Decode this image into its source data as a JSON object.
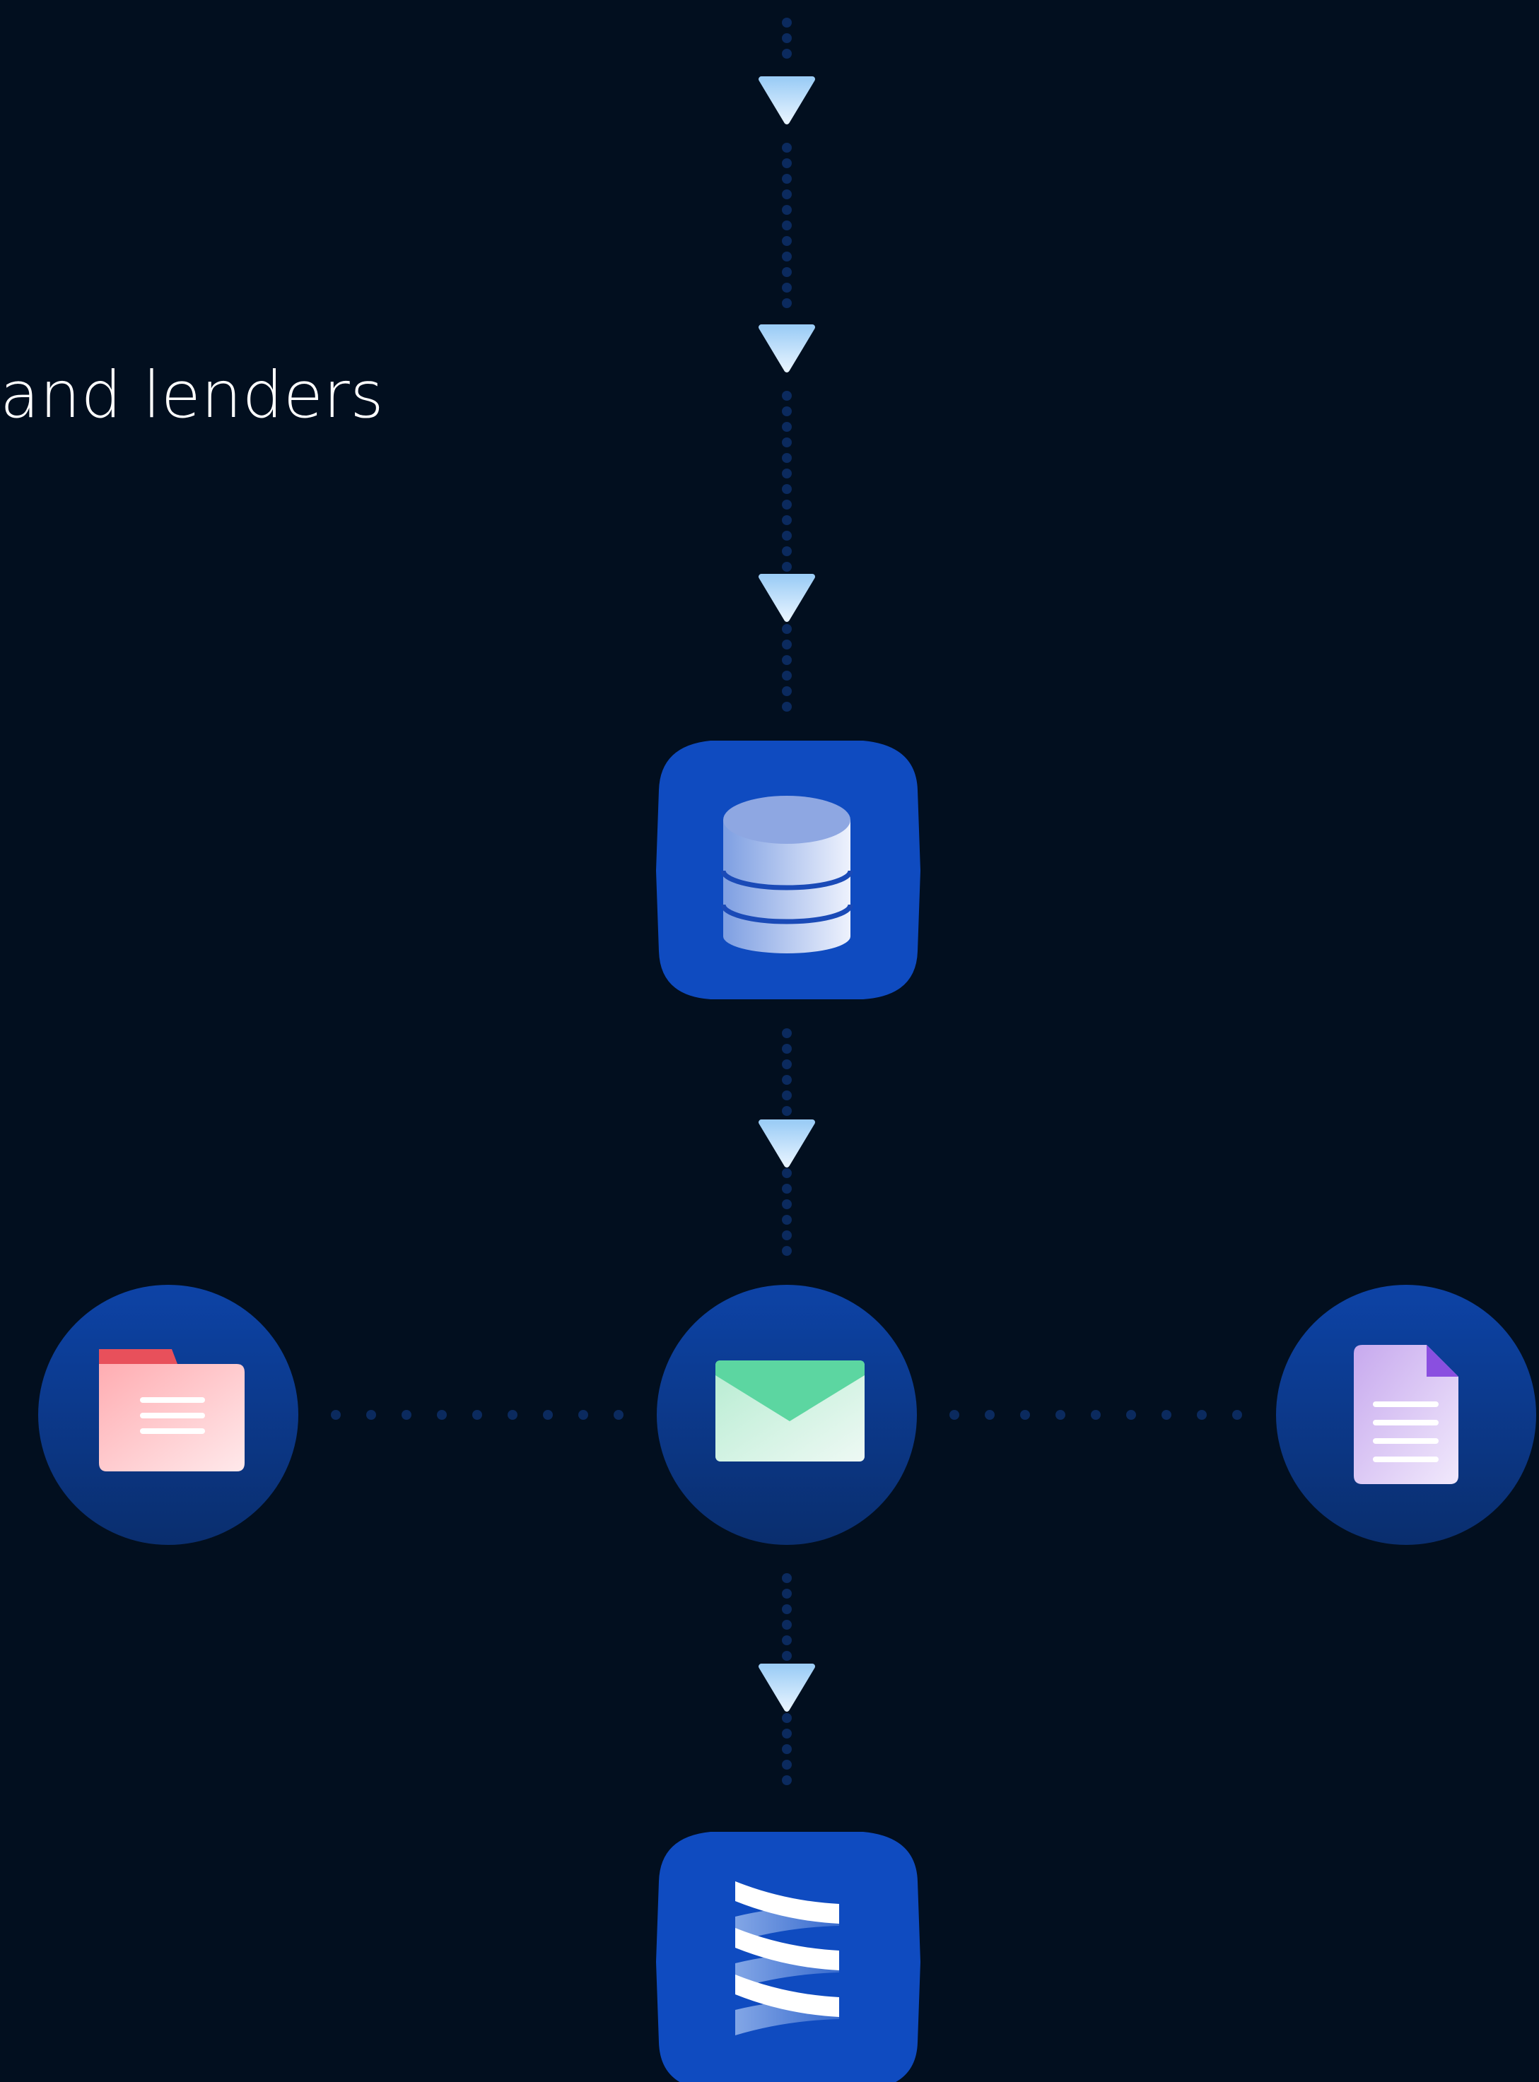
{
  "caption": "and lenders",
  "colors": {
    "background": "#020f1f",
    "connector_dot": "#0b2a5e",
    "arrow": "#c9e4fb",
    "node_blue": "#0f4bc0",
    "node_circle": "#0c3a8f",
    "folder_tab": "#e8505b",
    "envelope_flap": "#5cd6a1",
    "document_corner": "#8a4fe0"
  },
  "nodes": [
    {
      "name": "database-node",
      "icon": "database-icon"
    },
    {
      "name": "folder-node",
      "icon": "folder-icon"
    },
    {
      "name": "email-node",
      "icon": "envelope-icon"
    },
    {
      "name": "document-node",
      "icon": "document-icon"
    },
    {
      "name": "brand-node",
      "icon": "brand-logo-icon"
    }
  ]
}
